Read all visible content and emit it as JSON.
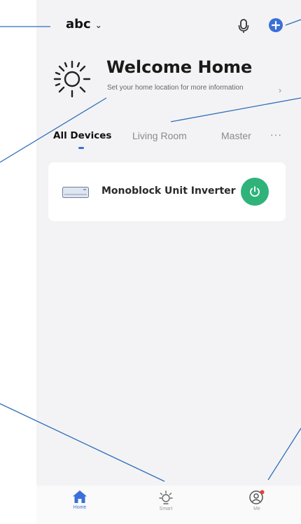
{
  "header": {
    "home_name": "abc",
    "home_chevron": "⌄"
  },
  "welcome": {
    "title": "Welcome Home",
    "subtitle": "Set your home location for more information",
    "arrow": "›"
  },
  "tabs": [
    {
      "label": "All Devices",
      "active": true
    },
    {
      "label": "Living Room",
      "active": false
    },
    {
      "label": "Master",
      "active": false
    }
  ],
  "tabs_more": "···",
  "devices": [
    {
      "name": "Monoblock Unit Inverter",
      "power_color": "#2fb37a"
    }
  ],
  "bottom_nav": [
    {
      "label": "Home",
      "icon": "home-icon",
      "active": true
    },
    {
      "label": "Smart",
      "icon": "smart-icon",
      "active": false
    },
    {
      "label": "Me",
      "icon": "me-icon",
      "active": false,
      "notification_dot": true
    }
  ],
  "colors": {
    "accent": "#3a6fd8",
    "power": "#2fb37a",
    "callout_line": "#2f6fb8",
    "notification": "#e0433a"
  }
}
